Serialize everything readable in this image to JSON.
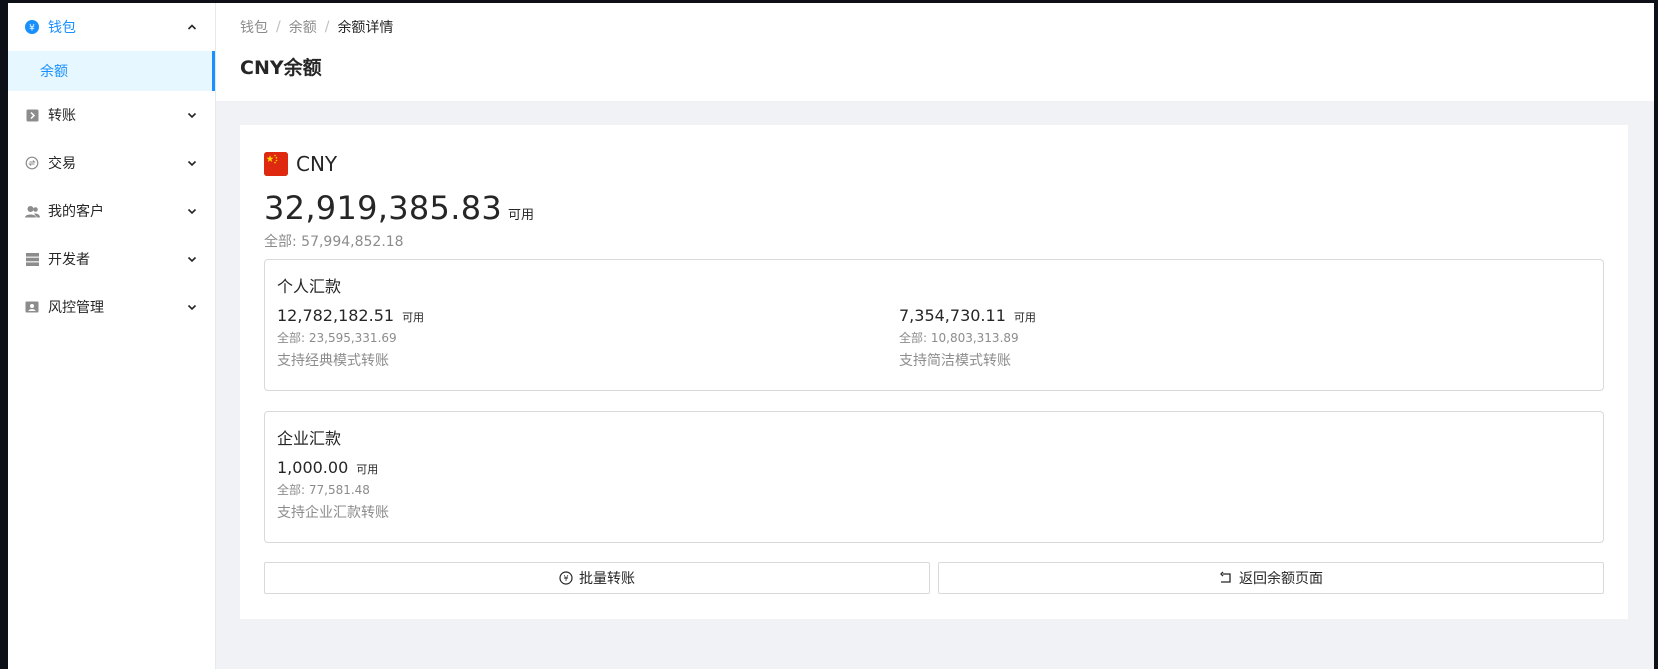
{
  "sidebar": {
    "items": [
      {
        "label": "钱包",
        "icon": "yuan-circle-icon",
        "expanded": true,
        "sub": [
          {
            "label": "余额",
            "active": true
          }
        ]
      },
      {
        "label": "转账",
        "icon": "transfer-icon",
        "expanded": false
      },
      {
        "label": "交易",
        "icon": "exchange-icon",
        "expanded": false
      },
      {
        "label": "我的客户",
        "icon": "users-icon",
        "expanded": false
      },
      {
        "label": "开发者",
        "icon": "server-icon",
        "expanded": false
      },
      {
        "label": "风控管理",
        "icon": "id-card-icon",
        "expanded": false
      }
    ]
  },
  "header": {
    "breadcrumb": [
      "钱包",
      "余额",
      "余额详情"
    ],
    "separator": "/",
    "title": "CNY余额"
  },
  "balance": {
    "currency": "CNY",
    "available_amount": "32,919,385.83",
    "available_label": "可用",
    "total_line": "全部: 57,994,852.18"
  },
  "personal": {
    "title": "个人汇款",
    "columns": [
      {
        "amount": "12,782,182.51",
        "available_label": "可用",
        "total": "全部: 23,595,331.69",
        "note": "支持经典模式转账"
      },
      {
        "amount": "7,354,730.11",
        "available_label": "可用",
        "total": "全部: 10,803,313.89",
        "note": "支持简洁模式转账"
      }
    ]
  },
  "enterprise": {
    "title": "企业汇款",
    "amount": "1,000.00",
    "available_label": "可用",
    "total": "全部: 77,581.48",
    "note": "支持企业汇款转账"
  },
  "actions": {
    "batch_transfer": "批量转账",
    "back_to_balance": "返回余额页面"
  },
  "colors": {
    "accent": "#1890ff",
    "accent_bg": "#e6f7ff",
    "flag_red": "#de2910",
    "page_bg": "#f0f2f5"
  }
}
